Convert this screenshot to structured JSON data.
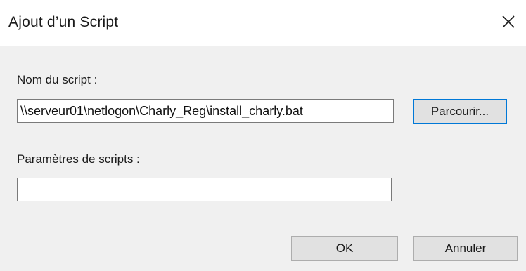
{
  "dialog": {
    "title": "Ajout d’un Script",
    "close_icon": "close-icon"
  },
  "script_name": {
    "label": "Nom du script :",
    "value": "\\\\serveur01\\netlogon\\Charly_Reg\\install_charly.bat",
    "browse_label": "Parcourir..."
  },
  "script_params": {
    "label": "Paramètres de scripts :",
    "value": ""
  },
  "footer": {
    "ok_label": "OK",
    "cancel_label": "Annuler"
  }
}
